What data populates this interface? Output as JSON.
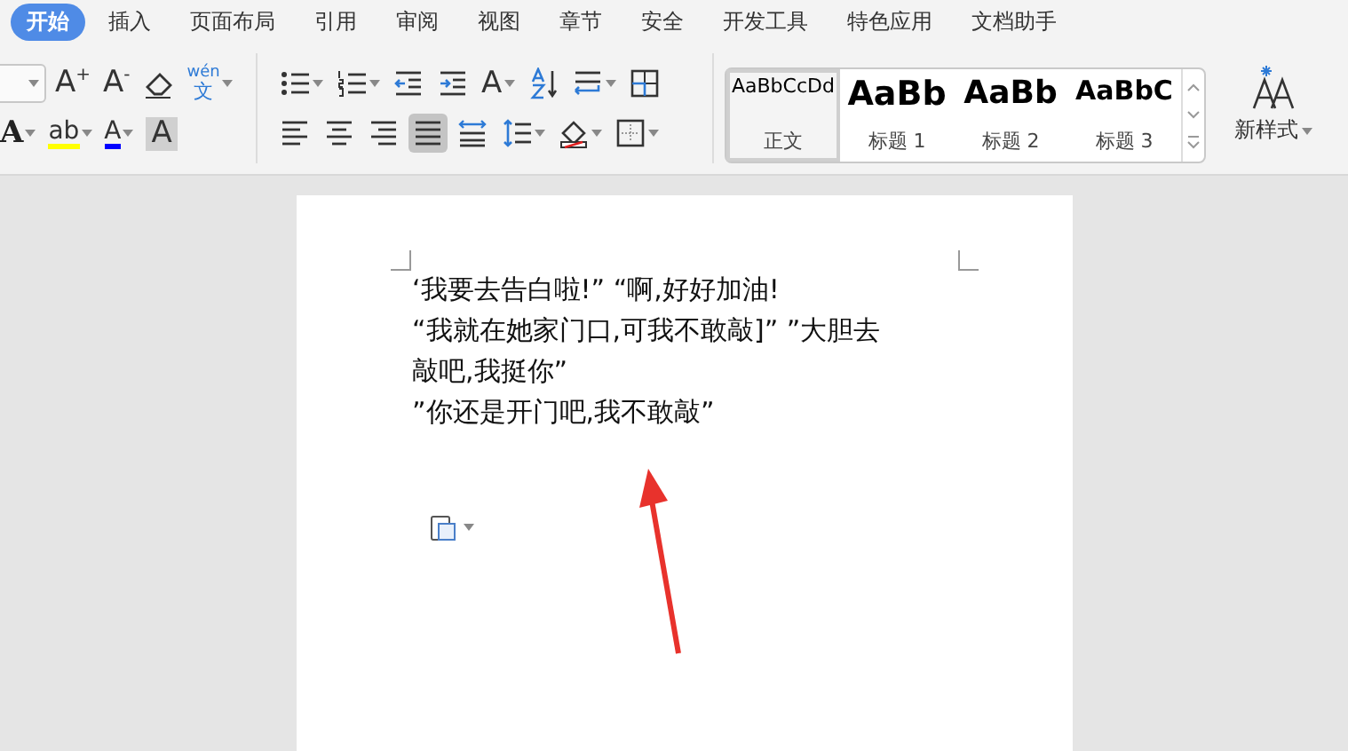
{
  "tabs": [
    {
      "label": "开始",
      "selected": true
    },
    {
      "label": "插入",
      "selected": false
    },
    {
      "label": "页面布局",
      "selected": false
    },
    {
      "label": "引用",
      "selected": false
    },
    {
      "label": "审阅",
      "selected": false
    },
    {
      "label": "视图",
      "selected": false
    },
    {
      "label": "章节",
      "selected": false
    },
    {
      "label": "安全",
      "selected": false
    },
    {
      "label": "开发工具",
      "selected": false
    },
    {
      "label": "特色应用",
      "selected": false
    },
    {
      "label": "文档助手",
      "selected": false
    }
  ],
  "font_group": {
    "row1": [
      {
        "kind": "glyph",
        "text": "A$^{+}$",
        "dropdown": false
      },
      {
        "kind": "glyph",
        "text": "A$^{-}$",
        "dropdown": false
      },
      {
        "kind": "eraser",
        "dropdown": false
      },
      {
        "kind": "pinyin",
        "top": "wén",
        "text": "文",
        "dropdown": true
      }
    ],
    "row2": [
      {
        "kind": "outline-glyph",
        "text": "A",
        "dropdown": true
      },
      {
        "kind": "glyph",
        "text": "ab",
        "color": "#ffff00",
        "dropdown": true
      },
      {
        "kind": "glyph",
        "text": "A",
        "color": "#0000ff",
        "dropdown": true
      },
      {
        "kind": "shaded-glyph",
        "text": "A",
        "dropdown": false
      }
    ]
  },
  "paragraph_group": {
    "row1": [
      {
        "kind": "bullets",
        "dropdown": true
      },
      {
        "kind": "numbering",
        "dropdown": true
      },
      {
        "kind": "outdent",
        "dropdown": false
      },
      {
        "kind": "indent",
        "dropdown": false
      },
      {
        "kind": "spacing-glyph",
        "text": "A",
        "dropdown": true
      },
      {
        "kind": "sort",
        "dropdown": false
      },
      {
        "kind": "wrap",
        "dropdown": true
      },
      {
        "kind": "table",
        "dropdown": false
      }
    ],
    "alignments": [
      {
        "kind": "left",
        "selected": false
      },
      {
        "kind": "center",
        "selected": false
      },
      {
        "kind": "right",
        "selected": false
      },
      {
        "kind": "justify",
        "selected": true
      },
      {
        "kind": "distribute",
        "selected": false
      }
    ],
    "row2": [
      {
        "kind": "line-spacing",
        "dropdown": true
      },
      {
        "kind": "fill",
        "dropdown": true
      },
      {
        "kind": "borders",
        "dropdown": true
      }
    ]
  },
  "styles": [
    {
      "kind": "body",
      "sample": "AaBbCcDd",
      "label": "正文",
      "selected": true
    },
    {
      "kind": "heading1",
      "sample": "AaBb",
      "label": "标题 1",
      "selected": false
    },
    {
      "kind": "heading2",
      "sample": "AaBb",
      "label": "标题 2",
      "selected": false
    },
    {
      "kind": "heading3",
      "sample": "AaBbC",
      "label": "标题 3",
      "selected": false
    }
  ],
  "new_style": {
    "label": "新样式"
  },
  "document": {
    "lines": [
      "‘我要去告白啦!” “啊,好好加油!",
      "“我就在她家门口,可我不敢敲]” ”大胆去",
      "敲吧,我挺你”",
      "”你还是开门吧,我不敢敲”"
    ]
  }
}
